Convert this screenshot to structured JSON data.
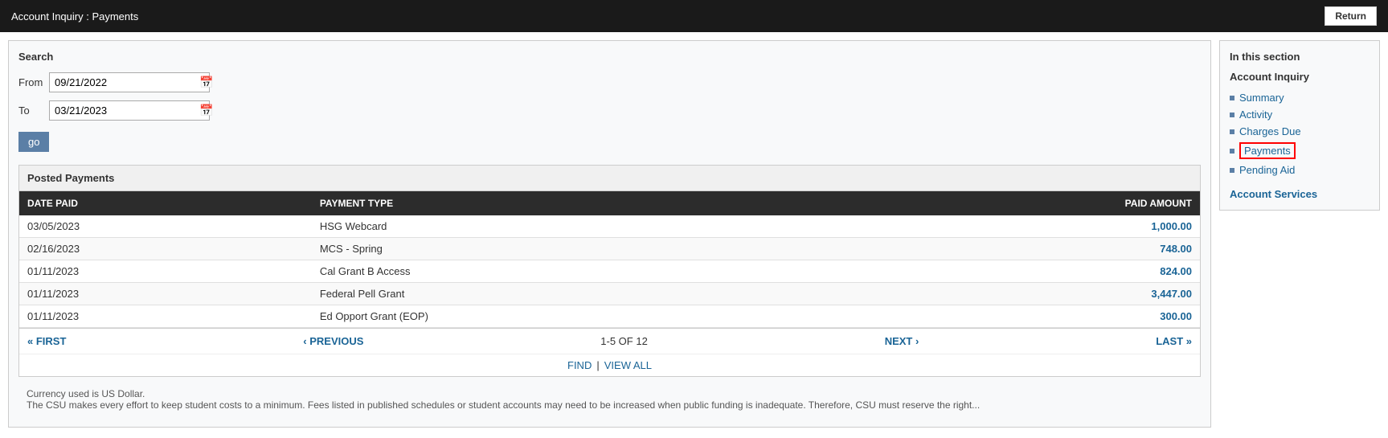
{
  "header": {
    "title": "Account Inquiry :  Payments",
    "return_label": "Return"
  },
  "search": {
    "section_label": "Search",
    "from_label": "From",
    "from_value": "09/21/2022",
    "to_label": "To",
    "to_value": "03/21/2023",
    "go_label": "go"
  },
  "posted_payments": {
    "section_label": "Posted Payments",
    "columns": [
      "DATE PAID",
      "PAYMENT TYPE",
      "PAID AMOUNT"
    ],
    "rows": [
      {
        "date": "03/05/2023",
        "type": "HSG Webcard",
        "amount": "1,000.00"
      },
      {
        "date": "02/16/2023",
        "type": "MCS - Spring",
        "amount": "748.00"
      },
      {
        "date": "01/11/2023",
        "type": "Cal Grant B Access",
        "amount": "824.00"
      },
      {
        "date": "01/11/2023",
        "type": "Federal Pell Grant",
        "amount": "3,447.00"
      },
      {
        "date": "01/11/2023",
        "type": "Ed Opport Grant (EOP)",
        "amount": "300.00"
      }
    ]
  },
  "pagination": {
    "first_label": "« FIRST",
    "previous_label": "‹ PREVIOUS",
    "info": "1-5 OF 12",
    "next_label": "NEXT ›",
    "last_label": "LAST »",
    "find_label": "FIND",
    "view_all_label": "VIEW ALL"
  },
  "footer": {
    "note1": "Currency used is US Dollar.",
    "note2": "The CSU makes every effort to keep student costs to a minimum. Fees listed in published schedules or student accounts may need to be increased when public funding is inadequate. Therefore, CSU must reserve the right..."
  },
  "sidebar": {
    "section_heading": "In this section",
    "account_inquiry_heading": "Account Inquiry",
    "nav_items": [
      {
        "label": "Summary",
        "active": false
      },
      {
        "label": "Activity",
        "active": false
      },
      {
        "label": "Charges Due",
        "active": false
      },
      {
        "label": "Payments",
        "active": true
      },
      {
        "label": "Pending Aid",
        "active": false
      }
    ],
    "services_label": "Account Services"
  }
}
